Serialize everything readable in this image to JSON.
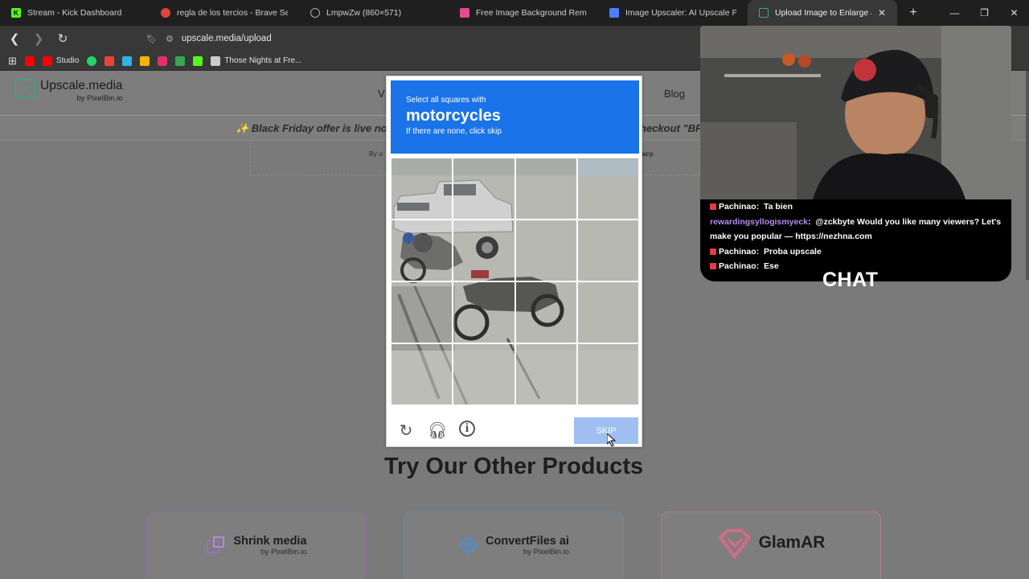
{
  "browser": {
    "tabs": [
      {
        "label": "Stream - Kick Dashboard",
        "icon": "kick-icon",
        "color": "#53fc18"
      },
      {
        "label": "regla de los tercios - Brave Search",
        "icon": "brave-search-icon",
        "color": "#e0453a"
      },
      {
        "label": "LmpwZw (860×571)",
        "icon": "globe-icon",
        "color": "#aaaaaa"
      },
      {
        "label": "Free Image Background Remover",
        "icon": "app-icon",
        "color": "#e44b8b"
      },
      {
        "label": "Image Upscaler: AI Upscale Photo",
        "icon": "app-icon",
        "color": "#4f7cff"
      },
      {
        "label": "Upload Image to Enlarge & E",
        "icon": "upscale-icon",
        "color": "#3fa58c",
        "active": true
      }
    ],
    "url": "upscale.media/upload",
    "bookmarks": [
      {
        "label": "",
        "icon": "youtube-icon",
        "color": "#ff0000"
      },
      {
        "label": "Studio",
        "icon": "youtube-studio-icon",
        "color": "#ff0000"
      },
      {
        "label": "",
        "icon": "whatsapp-icon",
        "color": "#25d366"
      },
      {
        "label": "",
        "icon": "gmail-icon",
        "color": "#ea4335"
      },
      {
        "label": "",
        "icon": "app-icon",
        "color": "#2fb4e8"
      },
      {
        "label": "",
        "icon": "app-icon",
        "color": "#f4b400"
      },
      {
        "label": "",
        "icon": "instagram-icon",
        "color": "#e1306c"
      },
      {
        "label": "",
        "icon": "drive-icon",
        "color": "#34a853"
      },
      {
        "label": "",
        "icon": "kick-icon",
        "color": "#53fc18"
      },
      {
        "label": "Those Nights at Fre...",
        "icon": "app-icon",
        "color": "#cccccc"
      }
    ]
  },
  "site": {
    "logo_name": "Upscale.media",
    "logo_sub": "by PixelBin.io",
    "nav_partial": "V",
    "nav_blog": "Blog",
    "promo_left": "✨ Black Friday offer is live no",
    "promo_right": "heckout \"BF",
    "terms_left": "By u",
    "terms_right": "acy.",
    "products_title": "Try Our Other Products",
    "products": [
      {
        "name": "Shrink media",
        "sub": "by PixelBin.io"
      },
      {
        "name": "ConvertFiles ai",
        "sub": "by PixelBin.io"
      },
      {
        "name": "GlamAR",
        "sub": ""
      }
    ]
  },
  "captcha": {
    "line1": "Select all squares with",
    "target": "motorcycles",
    "line3": "If there are none, click skip",
    "skip_label": "SKIP",
    "header_color": "#1a73e8"
  },
  "stream": {
    "chat": [
      {
        "user": "Pachinao",
        "text": "Ta bien",
        "badge": true
      },
      {
        "user": "rewardingsyllogismyeck",
        "text": "@zckbyte Would you like many viewers? Let's make you popular — https://nezhna.com",
        "badge": false,
        "purple": true
      },
      {
        "user": "Pachinao",
        "text": "Proba upscale",
        "badge": true
      },
      {
        "user": "Pachinao",
        "text": "Ese",
        "badge": true
      }
    ],
    "chat_label": "CHAT"
  }
}
